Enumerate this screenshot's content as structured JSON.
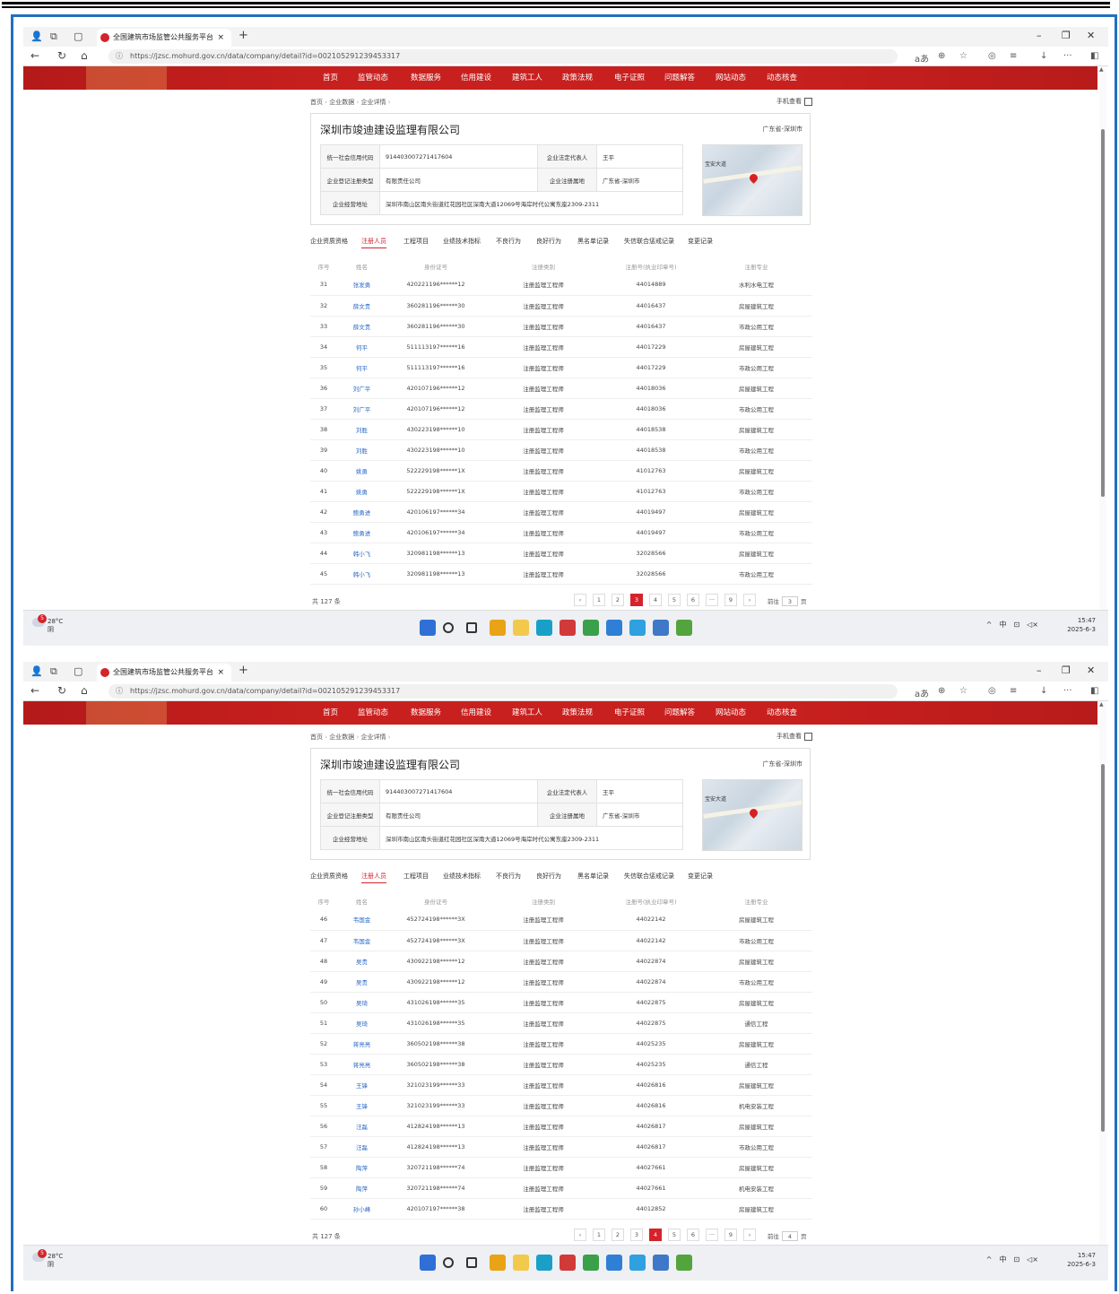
{
  "browser": {
    "tab_title": "全国建筑市场监管公共服务平台",
    "tab_close": "×",
    "new_tab": "+",
    "url": "https://jzsc.mohurd.gov.cn/data/company/detail?id=002105291239453317",
    "icons": [
      "back-icon",
      "refresh-icon",
      "home-icon",
      "read-aloud-icon",
      "zoom-icon",
      "favorite-icon",
      "copilot-icon",
      "favorites-bar-icon",
      "downloads-icon",
      "more-icon",
      "sidebar-icon"
    ]
  },
  "site": {
    "nav": [
      "首页",
      "监管动态",
      "数据服务",
      "信用建设",
      "建筑工人",
      "政策法规",
      "电子证照",
      "问题解答",
      "网站动态",
      "动态核查"
    ],
    "breadcrumb": [
      "首页",
      "企业数据",
      "企业详情"
    ],
    "mobile_view": "手机查看",
    "company": {
      "name": "深圳市竣迪建设监理有限公司",
      "region": "广东省-深圳市",
      "credit_code_label": "统一社会信用代码",
      "credit_code": "914403007271417604",
      "legal_rep_label": "企业法定代表人",
      "legal_rep": "王平",
      "reg_type_label": "企业登记注册类型",
      "reg_type": "有限责任公司",
      "reg_place_label": "企业注册属地",
      "reg_place": "广东省-深圳市",
      "address_label": "企业经营地址",
      "address": "深圳市南山区南头街道红花园社区深南大道12069号海岸时代公寓东座2309-2311",
      "map_label": "宝安大道"
    },
    "tabs": [
      "企业资质资格",
      "注册人员",
      "工程项目",
      "业绩技术指标",
      "不良行为",
      "良好行为",
      "黑名单记录",
      "失信联合惩戒记录",
      "变更记录"
    ],
    "columns": [
      "序号",
      "姓名",
      "身份证号",
      "注册类别",
      "注册号(执业印章号)",
      "注册专业"
    ],
    "total": "共 127 条",
    "goto_prefix": "前往",
    "goto_suffix": "页"
  },
  "screenshots": [
    {
      "rows": [
        [
          "31",
          "张发勇",
          "420221196******12",
          "注册监理工程师",
          "44014889",
          "水利水电工程"
        ],
        [
          "32",
          "薛文贵",
          "360281196******30",
          "注册监理工程师",
          "44016437",
          "房屋建筑工程"
        ],
        [
          "33",
          "薛文贵",
          "360281196******30",
          "注册监理工程师",
          "44016437",
          "市政公用工程"
        ],
        [
          "34",
          "何平",
          "511113197******16",
          "注册监理工程师",
          "44017229",
          "房屋建筑工程"
        ],
        [
          "35",
          "何平",
          "511113197******16",
          "注册监理工程师",
          "44017229",
          "市政公用工程"
        ],
        [
          "36",
          "刘广平",
          "420107196******12",
          "注册监理工程师",
          "44018036",
          "房屋建筑工程"
        ],
        [
          "37",
          "刘广平",
          "420107196******12",
          "注册监理工程师",
          "44018036",
          "市政公用工程"
        ],
        [
          "38",
          "刘胜",
          "430223198******10",
          "注册监理工程师",
          "44018538",
          "房屋建筑工程"
        ],
        [
          "39",
          "刘胜",
          "430223198******10",
          "注册监理工程师",
          "44018538",
          "市政公用工程"
        ],
        [
          "40",
          "姚勇",
          "522229198******1X",
          "注册监理工程师",
          "41012763",
          "房屋建筑工程"
        ],
        [
          "41",
          "姚勇",
          "522229198******1X",
          "注册监理工程师",
          "41012763",
          "市政公用工程"
        ],
        [
          "42",
          "鲍勇进",
          "420106197******34",
          "注册监理工程师",
          "44019497",
          "房屋建筑工程"
        ],
        [
          "43",
          "鲍勇进",
          "420106197******34",
          "注册监理工程师",
          "44019497",
          "市政公用工程"
        ],
        [
          "44",
          "韩小飞",
          "320981198******13",
          "注册监理工程师",
          "32028566",
          "房屋建筑工程"
        ],
        [
          "45",
          "韩小飞",
          "320981198******13",
          "注册监理工程师",
          "32028566",
          "市政公用工程"
        ]
      ],
      "pager": [
        "‹",
        "1",
        "2",
        "3",
        "4",
        "5",
        "6",
        "···",
        "9",
        "›"
      ],
      "current_page": "3",
      "goto_value": "3",
      "weather": {
        "temp": "28°C",
        "desc": "阴",
        "badge": "5"
      },
      "clock": {
        "time": "15:47",
        "date": "2025-6-3"
      }
    },
    {
      "rows": [
        [
          "46",
          "韦国金",
          "452724198******3X",
          "注册监理工程师",
          "44022142",
          "房屋建筑工程"
        ],
        [
          "47",
          "韦国金",
          "452724198******3X",
          "注册监理工程师",
          "44022142",
          "市政公用工程"
        ],
        [
          "48",
          "吴贵",
          "430922198******12",
          "注册监理工程师",
          "44022874",
          "房屋建筑工程"
        ],
        [
          "49",
          "吴贵",
          "430922198******12",
          "注册监理工程师",
          "44022874",
          "市政公用工程"
        ],
        [
          "50",
          "吴琦",
          "431026198******35",
          "注册监理工程师",
          "44022875",
          "房屋建筑工程"
        ],
        [
          "51",
          "吴琦",
          "431026198******35",
          "注册监理工程师",
          "44022875",
          "通信工程"
        ],
        [
          "52",
          "蒋亮亮",
          "360502198******38",
          "注册监理工程师",
          "44025235",
          "房屋建筑工程"
        ],
        [
          "53",
          "蒋亮亮",
          "360502198******38",
          "注册监理工程师",
          "44025235",
          "通信工程"
        ],
        [
          "54",
          "王锋",
          "321023199******33",
          "注册监理工程师",
          "44026816",
          "房屋建筑工程"
        ],
        [
          "55",
          "王锋",
          "321023199******33",
          "注册监理工程师",
          "44026816",
          "机电安装工程"
        ],
        [
          "56",
          "汪磊",
          "412824198******13",
          "注册监理工程师",
          "44026817",
          "房屋建筑工程"
        ],
        [
          "57",
          "汪磊",
          "412824198******13",
          "注册监理工程师",
          "44026817",
          "市政公用工程"
        ],
        [
          "58",
          "陶萍",
          "320721198******74",
          "注册监理工程师",
          "44027661",
          "房屋建筑工程"
        ],
        [
          "59",
          "陶萍",
          "320721198******74",
          "注册监理工程师",
          "44027661",
          "机电安装工程"
        ],
        [
          "60",
          "孙小峰",
          "420107197******38",
          "注册监理工程师",
          "44012852",
          "房屋建筑工程"
        ]
      ],
      "pager": [
        "‹",
        "1",
        "2",
        "3",
        "4",
        "5",
        "6",
        "···",
        "9",
        "›"
      ],
      "current_page": "4",
      "goto_value": "4",
      "weather": {
        "temp": "28°C",
        "desc": "阴",
        "badge": "5"
      },
      "clock": {
        "time": "15:47",
        "date": "2025-6-3"
      }
    }
  ],
  "colors": {
    "brand_red": "#c8201e",
    "link_blue": "#2a6ac8",
    "frame_blue": "#2070c0"
  }
}
